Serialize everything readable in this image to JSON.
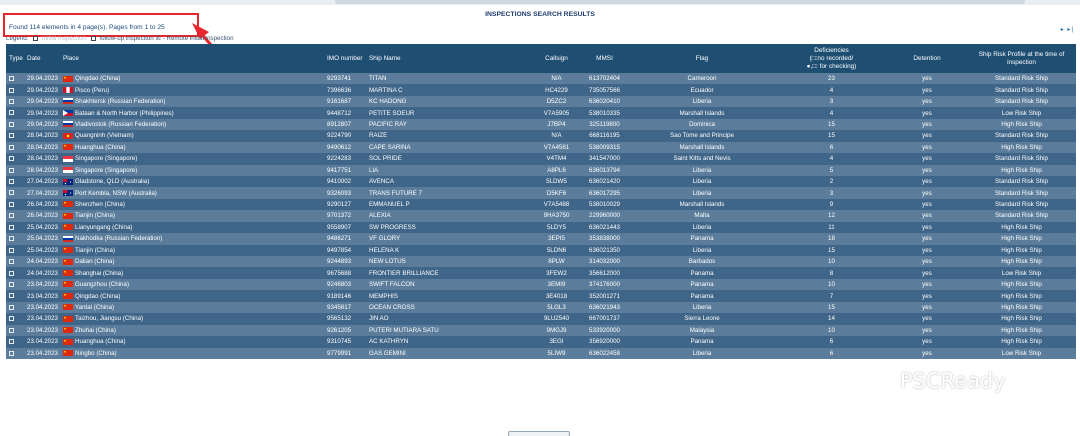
{
  "header": {
    "title": "INSPECTIONS SEARCH RESULTS",
    "found_text": "Found 114 elements in 4 page(s). Pages from 1 to 25",
    "legend_left": "Legend:",
    "legend_mid": "Initial inspection",
    "legend_hidden": "follow-up inspection",
    "legend_follow": "follow-up inspection",
    "legend_remote_mark": "☒",
    "legend_remote": " - Remote initial inspection",
    "pager": "▸ ▸|"
  },
  "columns": {
    "type": "Type",
    "date": "Date",
    "place": "Place",
    "imo": "IMO number",
    "ship": "Ship Name",
    "callsign": "Callsign",
    "mmsi": "MMSI",
    "flag": "Flag",
    "deficiencies": "Deficiencies",
    "deficiencies_sub1": "(□:no recorded/",
    "deficiencies_sub2": "●,□: for checking)",
    "detention": "Detention",
    "risk": "Ship Risk Profile at the time of inspection"
  },
  "flag_colors": {
    "China": [
      "#de2910",
      "#ffde00"
    ],
    "Peru": [
      "#d91023",
      "#ffffff"
    ],
    "Russia": [
      "#ffffff",
      "#0039a6",
      "#d52b1e"
    ],
    "Philippines": [
      "#0038a8",
      "#ce1126",
      "#ffffff"
    ],
    "Vietnam": [
      "#da251d",
      "#ffff00"
    ],
    "Singapore": [
      "#ef3340",
      "#ffffff"
    ],
    "Australia": [
      "#00247d",
      "#ffffff"
    ]
  },
  "rows": [
    {
      "date": "29.04.2023",
      "flag": "China",
      "place": "Qingdao (China)",
      "imo": "9293741",
      "ship": "TITAN",
      "callsign": "N/A",
      "mmsi": "613702404",
      "flag_state": "Cameroon",
      "def": "23",
      "det": "yes",
      "risk": "Standard Risk Ship"
    },
    {
      "date": "29.04.2023",
      "flag": "Peru",
      "place": "Pisco (Peru)",
      "imo": "7396636",
      "ship": "MARTINA C",
      "callsign": "HC4229",
      "mmsi": "735057566",
      "flag_state": "Ecuador",
      "def": "4",
      "det": "yes",
      "risk": "Standard Risk Ship"
    },
    {
      "date": "29.04.2023",
      "flag": "Russia",
      "place": "Shakhtersk (Russian Federation)",
      "imo": "9161687",
      "ship": "KC HADONG",
      "callsign": "D5ZC2",
      "mmsi": "636020410",
      "flag_state": "Liberia",
      "def": "3",
      "det": "yes",
      "risk": "Standard Risk Ship"
    },
    {
      "date": "29.04.2023",
      "flag": "Philippines",
      "place": "Bataan & North Harbor (Philippines)",
      "imo": "9448712",
      "ship": "PETITE SOEUR",
      "callsign": "V7A5905",
      "mmsi": "538010335",
      "flag_state": "Marshall Islands",
      "def": "4",
      "det": "yes",
      "risk": "Low Risk Ship"
    },
    {
      "date": "29.04.2023",
      "flag": "Russia",
      "place": "Vladivostok (Russian Federation)",
      "imo": "8912807",
      "ship": "PACIFIC RAY",
      "callsign": "J7BP4",
      "mmsi": "325119800",
      "flag_state": "Dominica",
      "def": "15",
      "det": "yes",
      "risk": "High Risk Ship"
    },
    {
      "date": "28.04.2023",
      "flag": "Vietnam",
      "place": "Quangninh (Vietnam)",
      "imo": "9224790",
      "ship": "RAIZE",
      "callsign": "N/A",
      "mmsi": "668116195",
      "flag_state": "Sao Tome and Principe",
      "def": "15",
      "det": "yes",
      "risk": "Standard Risk Ship"
    },
    {
      "date": "28.04.2023",
      "flag": "China",
      "place": "Huanghua (China)",
      "imo": "9490612",
      "ship": "CAPE SARINA",
      "callsign": "V7A4581",
      "mmsi": "538009315",
      "flag_state": "Marshall Islands",
      "def": "6",
      "det": "yes",
      "risk": "High Risk Ship"
    },
    {
      "date": "28.04.2023",
      "flag": "Singapore",
      "place": "Singapore (Singapore)",
      "imo": "9224283",
      "ship": "SOL PRIDE",
      "callsign": "V4TM4",
      "mmsi": "341547000",
      "flag_state": "Saint Kitts and Nevis",
      "def": "4",
      "det": "yes",
      "risk": "Standard Risk Ship"
    },
    {
      "date": "28.04.2023",
      "flag": "Singapore",
      "place": "Singapore (Singapore)",
      "imo": "9417751",
      "ship": "LIA",
      "callsign": "A8PL6",
      "mmsi": "636013794",
      "flag_state": "Liberia",
      "def": "5",
      "det": "yes",
      "risk": "High Risk Ship"
    },
    {
      "date": "27.04.2023",
      "flag": "Australia",
      "place": "Gladstone, QLD (Australia)",
      "imo": "9410002",
      "ship": "AVENCA",
      "callsign": "5LDW5",
      "mmsi": "636021420",
      "flag_state": "Liberia",
      "def": "2",
      "det": "yes",
      "risk": "Standard Risk Ship"
    },
    {
      "date": "27.04.2023",
      "flag": "Australia",
      "place": "Port Kembla, NSW (Australia)",
      "imo": "9326093",
      "ship": "TRANS FUTURE 7",
      "callsign": "D5KF6",
      "mmsi": "636017295",
      "flag_state": "Liberia",
      "def": "3",
      "det": "yes",
      "risk": "Standard Risk Ship"
    },
    {
      "date": "26.04.2023",
      "flag": "China",
      "place": "Shenzhen (China)",
      "imo": "9290127",
      "ship": "EMMANUEL P",
      "callsign": "V7A5488",
      "mmsi": "538010029",
      "flag_state": "Marshall Islands",
      "def": "9",
      "det": "yes",
      "risk": "Standard Risk Ship"
    },
    {
      "date": "26.04.2023",
      "flag": "China",
      "place": "Tianjin (China)",
      "imo": "9701372",
      "ship": "ALEXIA",
      "callsign": "9HA3750",
      "mmsi": "229960000",
      "flag_state": "Malta",
      "def": "12",
      "det": "yes",
      "risk": "Standard Risk Ship"
    },
    {
      "date": "25.04.2023",
      "flag": "China",
      "place": "Lianyungang (China)",
      "imo": "9558907",
      "ship": "SW PROGRESS",
      "callsign": "5LDY5",
      "mmsi": "636021443",
      "flag_state": "Liberia",
      "def": "11",
      "det": "yes",
      "risk": "High Risk Ship"
    },
    {
      "date": "25.04.2023",
      "flag": "Russia",
      "place": "Nakhodka (Russian Federation)",
      "imo": "9486271",
      "ship": "VF GLORY",
      "callsign": "3EPI5",
      "mmsi": "353838000",
      "flag_state": "Panama",
      "def": "18",
      "det": "yes",
      "risk": "High Risk Ship"
    },
    {
      "date": "25.04.2023",
      "flag": "China",
      "place": "Tianjin (China)",
      "imo": "9497854",
      "ship": "HELENA K",
      "callsign": "5LDN6",
      "mmsi": "636021350",
      "flag_state": "Liberia",
      "def": "15",
      "det": "yes",
      "risk": "High Risk Ship"
    },
    {
      "date": "24.04.2023",
      "flag": "China",
      "place": "Dalian (China)",
      "imo": "9244893",
      "ship": "NEW LOTUS",
      "callsign": "8PLW",
      "mmsi": "314032000",
      "flag_state": "Barbados",
      "def": "10",
      "det": "yes",
      "risk": "High Risk Ship"
    },
    {
      "date": "24.04.2023",
      "flag": "China",
      "place": "Shanghai (China)",
      "imo": "9675688",
      "ship": "FRONTIER BRILLIANCE",
      "callsign": "3FEW2",
      "mmsi": "356612000",
      "flag_state": "Panama",
      "def": "8",
      "det": "yes",
      "risk": "Low Risk Ship"
    },
    {
      "date": "23.04.2023",
      "flag": "China",
      "place": "Guangzhou (China)",
      "imo": "9246803",
      "ship": "SWIFT FALCON",
      "callsign": "3EMI9",
      "mmsi": "374176000",
      "flag_state": "Panama",
      "def": "10",
      "det": "yes",
      "risk": "High Risk Ship"
    },
    {
      "date": "23.04.2023",
      "flag": "China",
      "place": "Qingdao (China)",
      "imo": "9189146",
      "ship": "MEMPHIS",
      "callsign": "3E4018",
      "mmsi": "352001271",
      "flag_state": "Panama",
      "def": "7",
      "det": "yes",
      "risk": "High Risk Ship"
    },
    {
      "date": "23.04.2023",
      "flag": "China",
      "place": "Yantai (China)",
      "imo": "9345817",
      "ship": "OCEAN CROSS",
      "callsign": "5LGL3",
      "mmsi": "636021943",
      "flag_state": "Liberia",
      "def": "15",
      "det": "yes",
      "risk": "High Risk Ship"
    },
    {
      "date": "23.04.2023",
      "flag": "China",
      "place": "Taizhou, Jiangsu (China)",
      "imo": "9565132",
      "ship": "JIN AO",
      "callsign": "9LU2540",
      "mmsi": "667001737",
      "flag_state": "Sierra Leone",
      "def": "14",
      "det": "yes",
      "risk": "High Risk Ship"
    },
    {
      "date": "23.04.2023",
      "flag": "China",
      "place": "Zhuhai (China)",
      "imo": "9261205",
      "ship": "PUTERI MUTIARA SATU",
      "callsign": "9MGJ9",
      "mmsi": "533920000",
      "flag_state": "Malaysia",
      "def": "10",
      "det": "yes",
      "risk": "High Risk Ship"
    },
    {
      "date": "23.04.2023",
      "flag": "China",
      "place": "Huanghua (China)",
      "imo": "9310745",
      "ship": "AC KATHRYN",
      "callsign": "3EGI",
      "mmsi": "356920000",
      "flag_state": "Panama",
      "def": "6",
      "det": "yes",
      "risk": "High Risk Ship"
    },
    {
      "date": "23.04.2023",
      "flag": "China",
      "place": "Ningbo (China)",
      "imo": "9779991",
      "ship": "GAS GEMINI",
      "callsign": "5LIW9",
      "mmsi": "636022458",
      "flag_state": "Liberia",
      "def": "6",
      "det": "yes",
      "risk": "Low Risk Ship"
    }
  ],
  "watermark": {
    "text": "PSCReady",
    "icon": "wechat-icon"
  }
}
